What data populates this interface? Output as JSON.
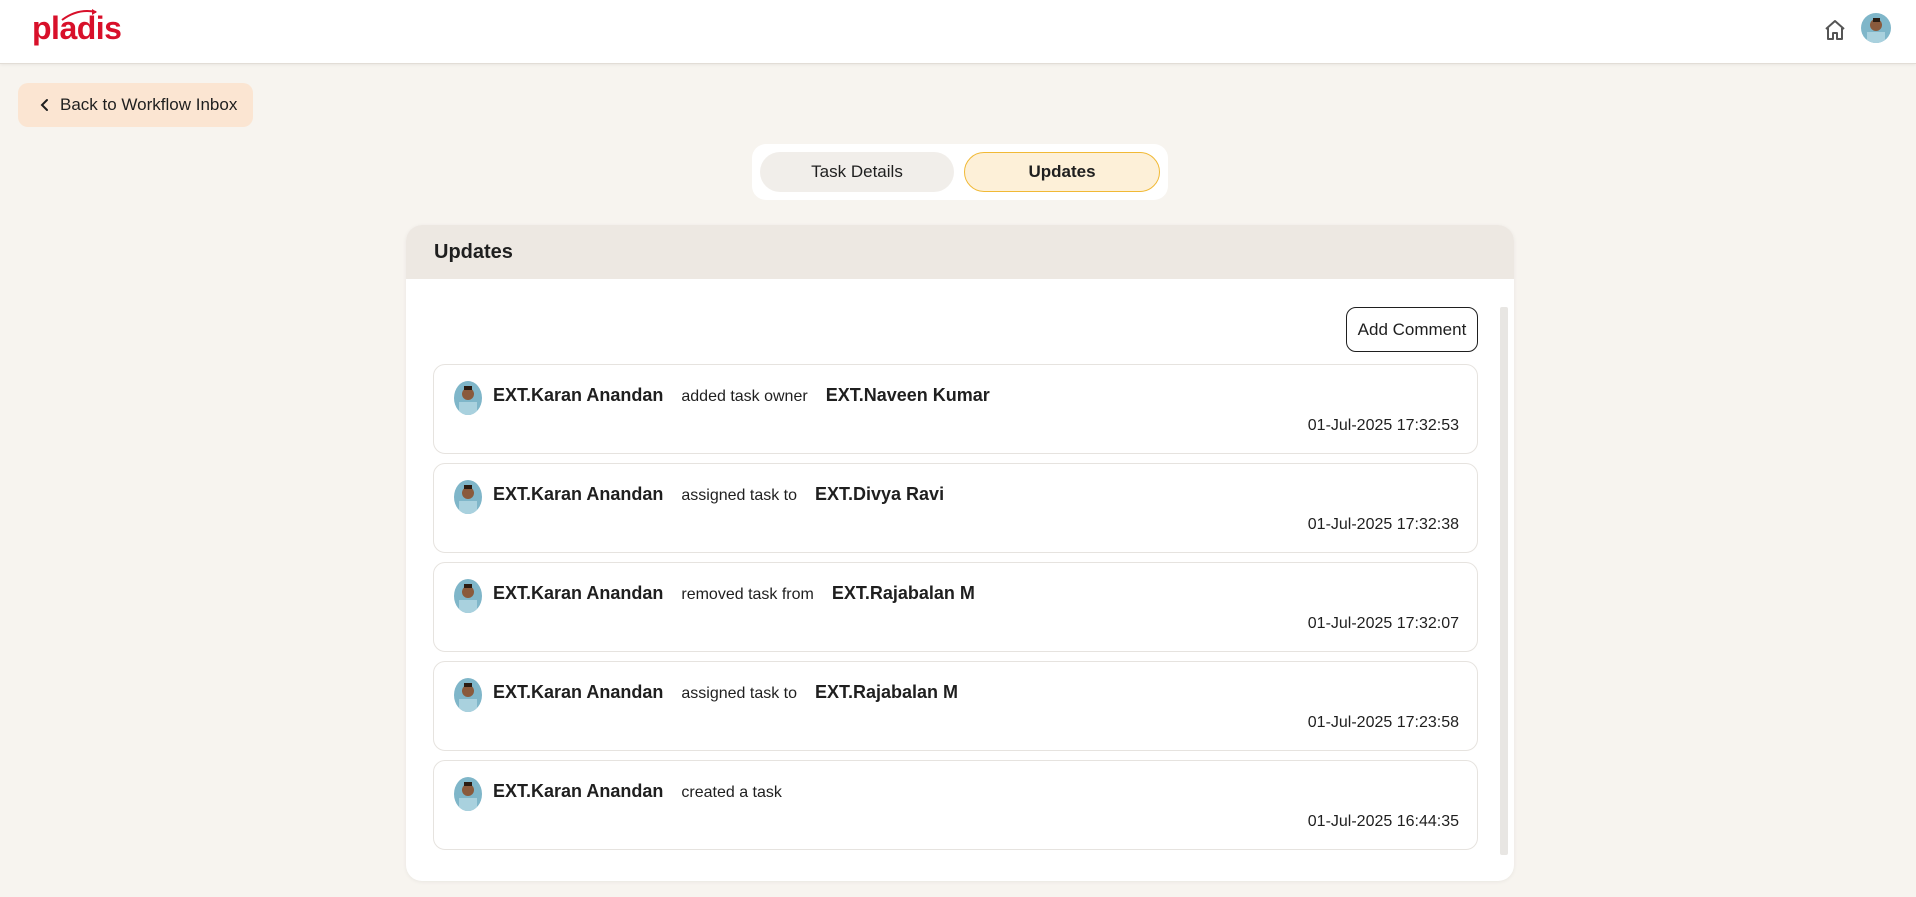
{
  "header": {
    "logo_text": "pladis",
    "brand_color": "#d8102a",
    "home_icon": "home-icon",
    "avatar_icon": "user-avatar"
  },
  "back_button": {
    "label": "Back to Workflow Inbox",
    "icon": "chevron-left-icon"
  },
  "tabs": [
    {
      "label": "Task Details",
      "active": false
    },
    {
      "label": "Updates",
      "active": true
    }
  ],
  "panel": {
    "title": "Updates",
    "add_comment_label": "Add Comment",
    "updates": [
      {
        "actor": "EXT.Karan Anandan",
        "action": "added task owner",
        "target": "EXT.Naveen Kumar",
        "timestamp": "01-Jul-2025 17:32:53"
      },
      {
        "actor": "EXT.Karan Anandan",
        "action": "assigned task to",
        "target": "EXT.Divya Ravi",
        "timestamp": "01-Jul-2025 17:32:38"
      },
      {
        "actor": "EXT.Karan Anandan",
        "action": "removed task from",
        "target": "EXT.Rajabalan M",
        "timestamp": "01-Jul-2025 17:32:07"
      },
      {
        "actor": "EXT.Karan Anandan",
        "action": "assigned task to",
        "target": "EXT.Rajabalan M",
        "timestamp": "01-Jul-2025 17:23:58"
      },
      {
        "actor": "EXT.Karan Anandan",
        "action": "created a task",
        "target": "",
        "timestamp": "01-Jul-2025 16:44:35"
      }
    ]
  },
  "colors": {
    "page_bg": "#f7f4ef",
    "back_button_bg": "#fbe5d2",
    "active_tab_bg": "#fdf0d8",
    "active_tab_border": "#f1b935",
    "panel_header_bg": "#ede8e2"
  }
}
